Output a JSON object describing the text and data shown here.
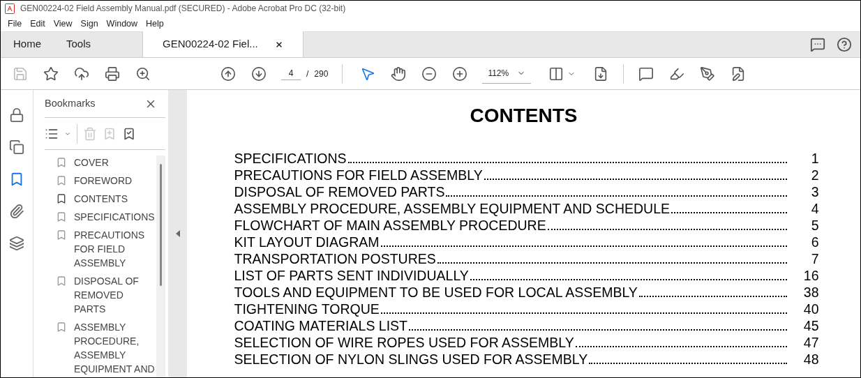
{
  "window": {
    "title": "GEN00224-02 Field Assembly Manual.pdf (SECURED) - Adobe Acrobat Pro DC (32-bit)"
  },
  "menu": [
    "File",
    "Edit",
    "View",
    "Sign",
    "Window",
    "Help"
  ],
  "tabs": [
    {
      "label": "Home",
      "selected": false,
      "kind": "nav"
    },
    {
      "label": "Tools",
      "selected": false,
      "kind": "nav"
    },
    {
      "label": "GEN00224-02 Fiel...",
      "selected": true,
      "kind": "document"
    }
  ],
  "toolbar": {
    "page": "4",
    "separator": "/",
    "page_count": "290",
    "zoom": "112%",
    "save_disabled": true,
    "pointer_selected": true
  },
  "left_rail": [
    {
      "kind": "lock",
      "selected": false
    },
    {
      "kind": "pages",
      "selected": false
    },
    {
      "kind": "bookmarks",
      "selected": true
    },
    {
      "kind": "attachments",
      "selected": false
    },
    {
      "kind": "layers",
      "selected": false
    }
  ],
  "bookmarks_panel": {
    "title": "Bookmarks",
    "delete_disabled": true,
    "add_disabled": true,
    "items": [
      {
        "label": "COVER",
        "selected": false
      },
      {
        "label": "FOREWORD",
        "selected": false
      },
      {
        "label": "CONTENTS",
        "selected": true
      },
      {
        "label": "SPECIFICATIONS",
        "selected": false
      },
      {
        "label": "PRECAUTIONS FOR FIELD ASSEMBLY",
        "selected": false
      },
      {
        "label": "DISPOSAL OF REMOVED PARTS",
        "selected": false
      },
      {
        "label": "ASSEMBLY PROCEDURE, ASSEMBLY EQUIPMENT AND",
        "selected": false
      }
    ]
  },
  "document": {
    "heading": "CONTENTS",
    "entries": [
      {
        "title": "SPECIFICATIONS",
        "page": "1"
      },
      {
        "title": "PRECAUTIONS FOR FIELD ASSEMBLY",
        "page": "2"
      },
      {
        "title": "DISPOSAL OF REMOVED PARTS",
        "page": "3"
      },
      {
        "title": "ASSEMBLY PROCEDURE, ASSEMBLY EQUIPMENT AND SCHEDULE",
        "page": "4"
      },
      {
        "title": "FLOWCHART OF MAIN ASSEMBLY PROCEDURE",
        "page": "5"
      },
      {
        "title": "KIT LAYOUT DIAGRAM",
        "page": "6"
      },
      {
        "title": "TRANSPORTATION POSTURES",
        "page": "7"
      },
      {
        "title": "LIST OF PARTS SENT INDIVIDUALLY",
        "page": "16"
      },
      {
        "title": "TOOLS AND EQUIPMENT TO BE USED FOR LOCAL ASSEMBLY",
        "page": "38"
      },
      {
        "title": "TIGHTENING TORQUE",
        "page": "40"
      },
      {
        "title": "COATING MATERIALS LIST",
        "page": "45"
      },
      {
        "title": "SELECTION OF WIRE ROPES USED FOR ASSEMBLY",
        "page": "47"
      },
      {
        "title": "SELECTION OF NYLON SLINGS USED FOR ASSEMBLY",
        "page": "48"
      }
    ]
  }
}
